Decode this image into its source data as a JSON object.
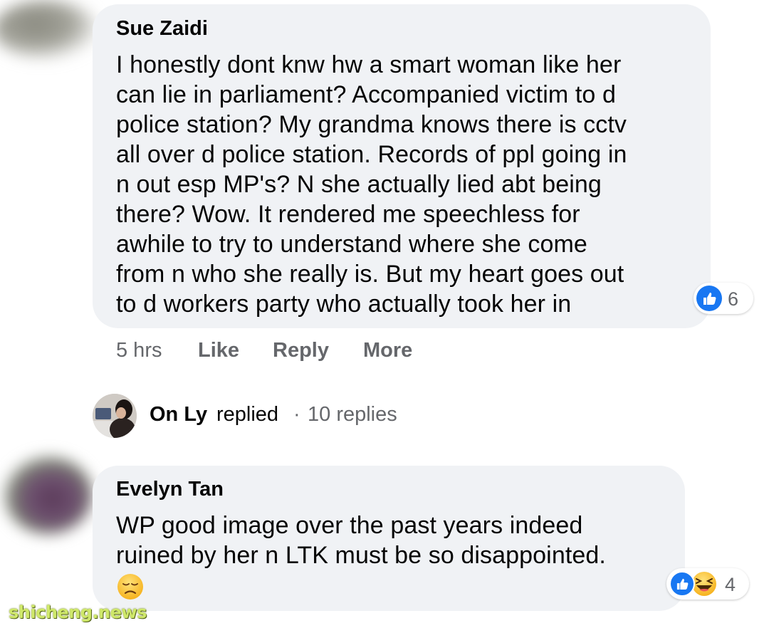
{
  "comment1": {
    "author": "Sue Zaidi",
    "lines": [
      "I honestly dont knw hw a smart woman like her",
      "can lie in parliament? Accompanied victim to d",
      "police station? My grandma knows there is cctv",
      "all over d police station. Records of ppl going in",
      "n out esp MP's? N she actually lied abt being",
      "there? Wow. It rendered me speechless for",
      "awhile to try to understand where she come",
      "from n who she really is. But my heart goes out",
      "to d workers party who actually took her in"
    ],
    "reaction_count": "6",
    "time": "5 hrs",
    "like_label": "Like",
    "reply_label": "Reply",
    "more_label": "More"
  },
  "replies_summary": {
    "name": "On Ly",
    "replied_text": "replied",
    "separator": "·",
    "count_text": "10 replies"
  },
  "comment2": {
    "author": "Evelyn Tan",
    "lines": [
      "WP good image over the past years indeed",
      "ruined by her n LTK must be so disappointed."
    ],
    "emoji": "disappointed-face",
    "reaction_count": "4"
  },
  "watermark": "shicheng.news",
  "colors": {
    "bubble": "#f0f2f5",
    "like_blue": "#1877f2",
    "meta_gray": "#65676b"
  }
}
